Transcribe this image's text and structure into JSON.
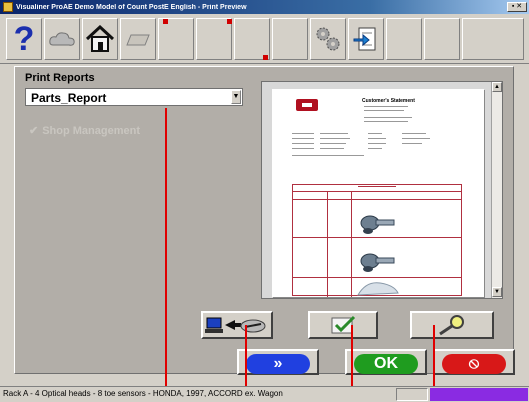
{
  "window": {
    "title": "Visualiner ProAE  Demo Model of Count PostE  English  - Print Preview"
  },
  "toolbar": {
    "icons": [
      "help-icon",
      "cloud-icon",
      "home-icon",
      "folder-icon",
      "tab-icon",
      "tab-icon",
      "tab-icon",
      "tab-icon",
      "gears-icon",
      "import-icon",
      "blank",
      "blank"
    ],
    "help_label": "?"
  },
  "main": {
    "title": "Print Reports",
    "report_select": {
      "value": "Parts_Report"
    },
    "shop_management": {
      "label": "Shop Management",
      "checked": true
    }
  },
  "preview": {
    "doc_title": "Customer's Statement",
    "section_heading": "Requested Parts"
  },
  "actions": {
    "transfer_icon": "computer-transfer-icon",
    "check_icon": "checkmark-icon",
    "zoom_icon": "magnifier-icon"
  },
  "bottom": {
    "forward_label": "»",
    "ok_label": "OK",
    "cancel_label": "⦸"
  },
  "status": {
    "message": "Rack A - 4 Optical heads - 8 toe sensors - HONDA, 1997, ACCORD ex. Wagon"
  },
  "colors": {
    "accent_blue": "#1b2fae",
    "ok_green": "#1f9c1f",
    "cancel_red": "#d81818",
    "forward_blue": "#2040e0",
    "pointer_red": "#e00000"
  }
}
